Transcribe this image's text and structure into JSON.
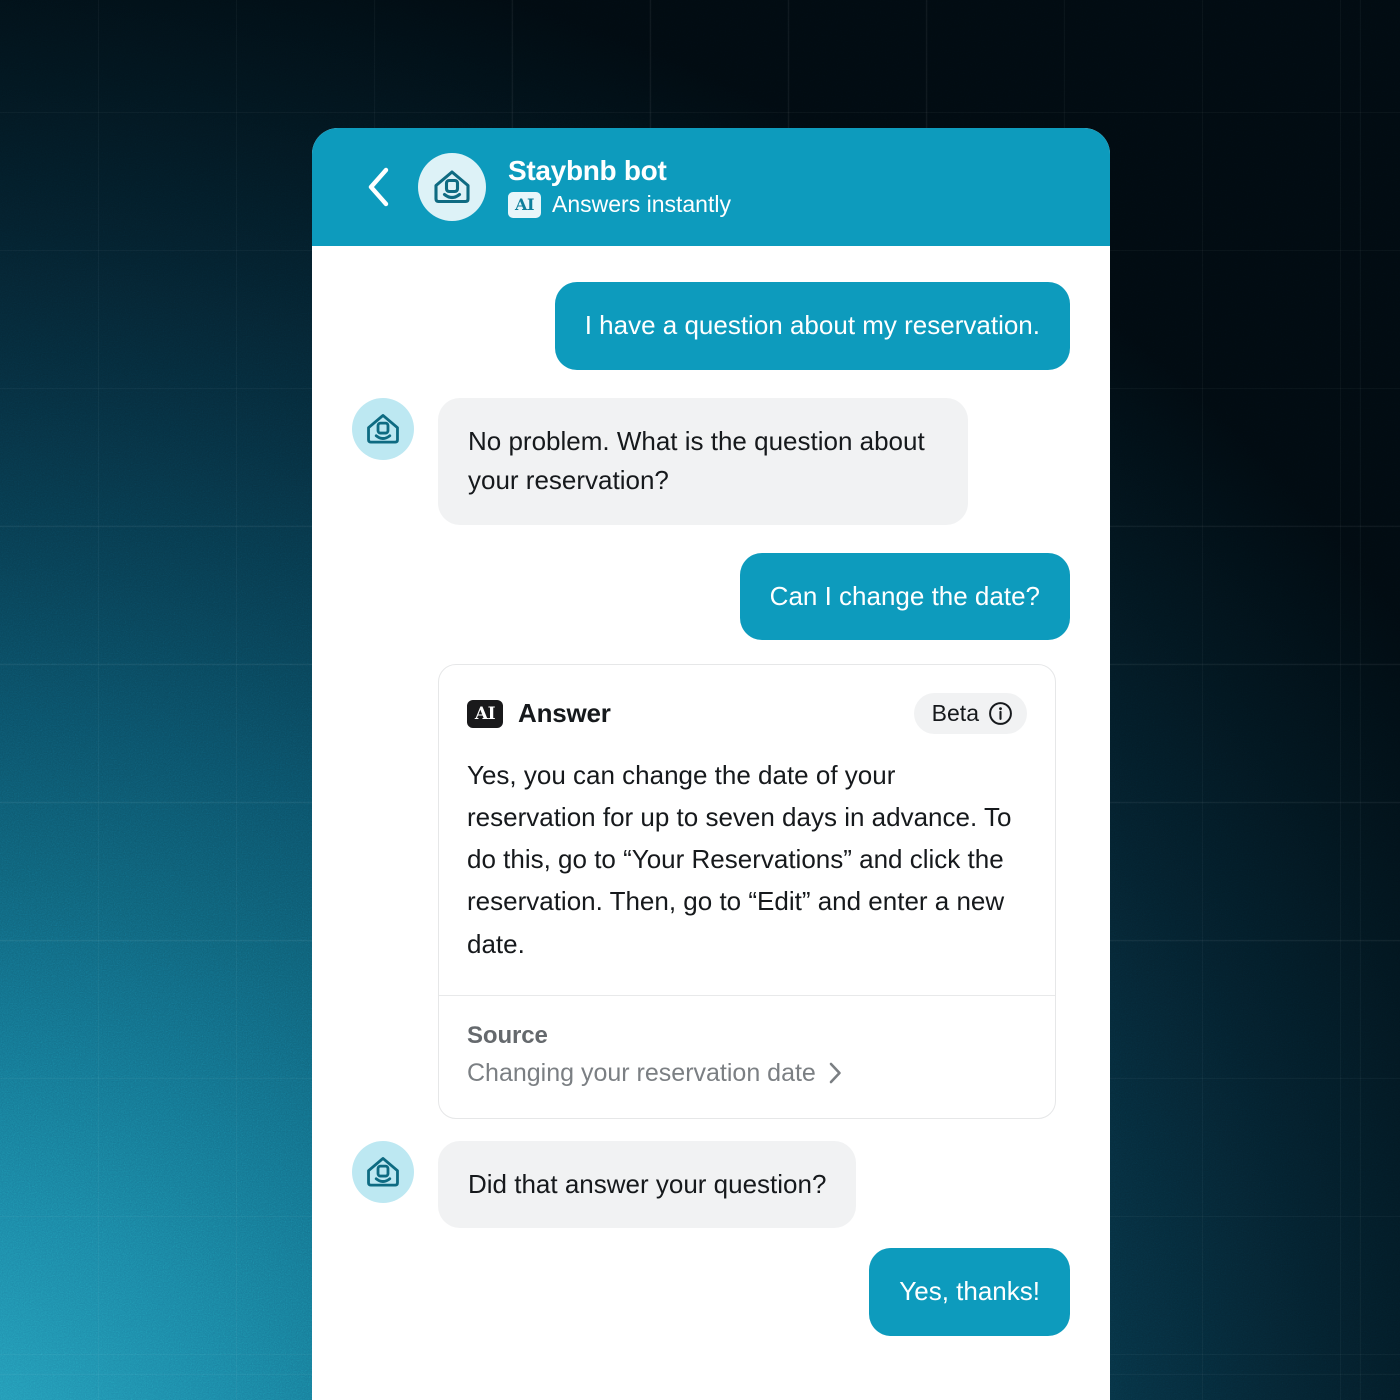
{
  "header": {
    "back_icon": "chevron-left-icon",
    "avatar_icon": "staybnb-house-bot-avatar-icon",
    "title": "Staybnb bot",
    "ai_badge": "AI",
    "subtitle": "Answers instantly",
    "accent_color": "#0d9bbd"
  },
  "conversation": [
    {
      "sender": "user",
      "text": "I have a question about my reservation."
    },
    {
      "sender": "bot",
      "text": "No problem. What is the question about your reservation?"
    },
    {
      "sender": "user",
      "text": "Can I change the date?"
    },
    {
      "sender": "bot",
      "text": "Did that answer your question?"
    },
    {
      "sender": "user",
      "text": "Yes, thanks!"
    }
  ],
  "answer_card": {
    "ai_badge": "AI",
    "label": "Answer",
    "beta_label": "Beta",
    "info_icon": "info-circle-icon",
    "body": "Yes, you can change the date of your reservation for up to seven days in advance. To do this, go to “Your Reservations” and click the reservation. Then, go to “Edit” and enter a new date.",
    "source_label": "Source",
    "source_link": "Changing your reservation date",
    "source_chevron_icon": "chevron-right-icon"
  },
  "colors": {
    "brand_teal": "#0d9bbd",
    "bot_bubble": "#f1f2f3",
    "avatar_light": "#bde8f2",
    "text_dark": "#16191c",
    "text_muted": "#7b7f83",
    "badge_dark": "#19191b"
  }
}
